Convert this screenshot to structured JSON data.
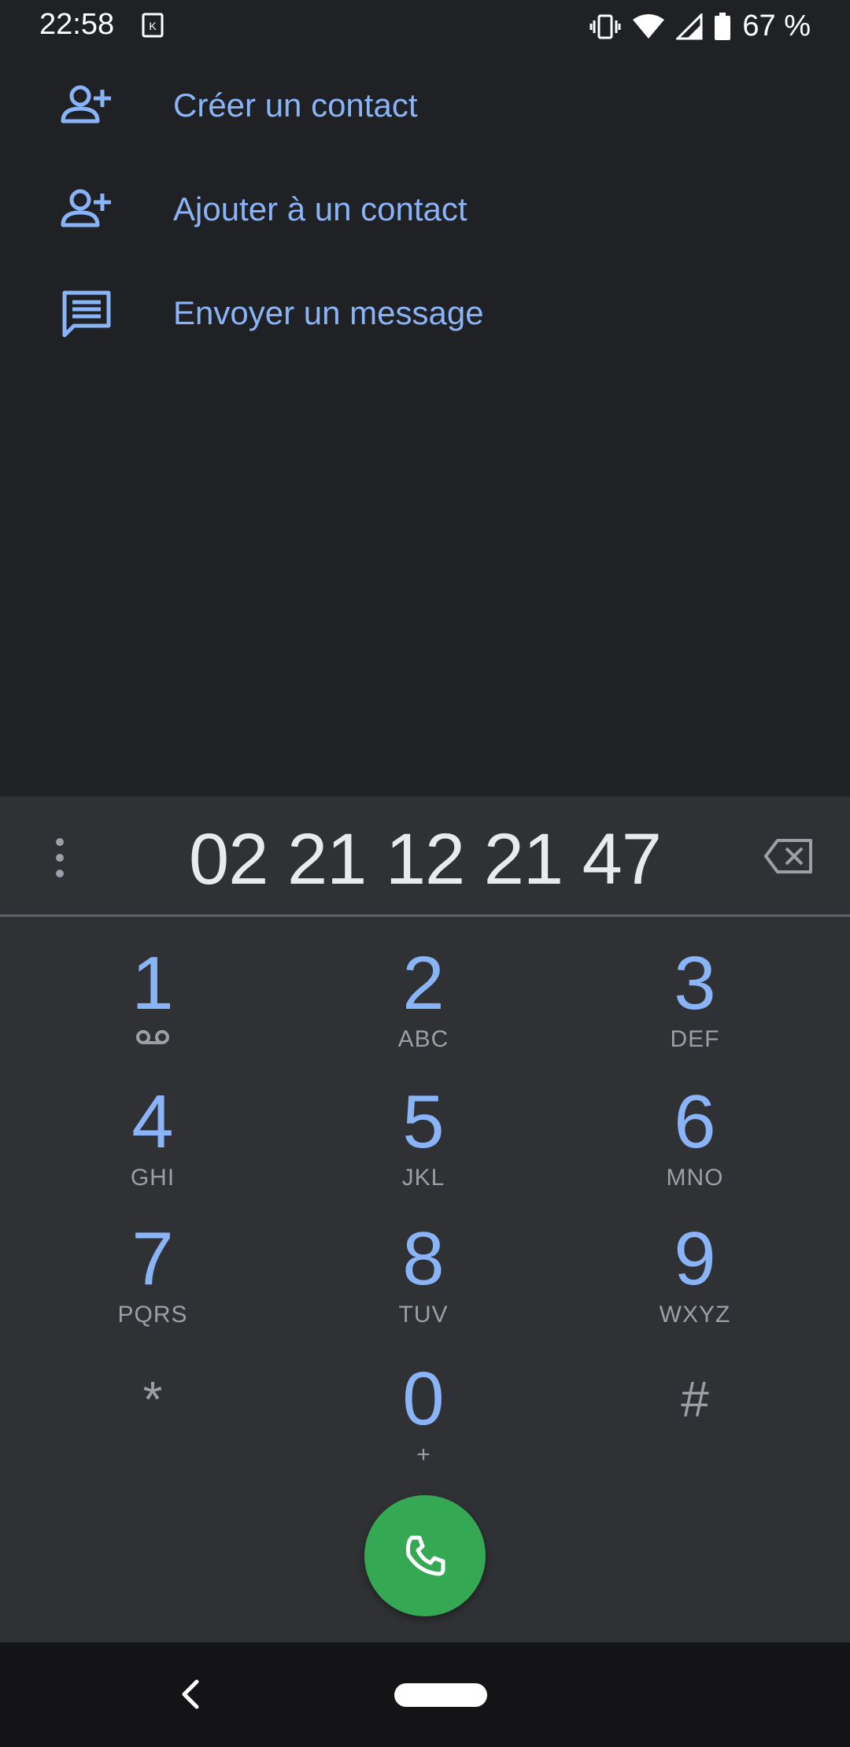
{
  "status_bar": {
    "time": "22:58",
    "battery_text": "67 %",
    "icons": [
      "notification-k-icon",
      "vibrate-icon",
      "wifi-icon",
      "signal-icon",
      "battery-icon"
    ]
  },
  "actions": [
    {
      "label": "Créer un contact",
      "icon": "person-add-icon"
    },
    {
      "label": "Ajouter à un contact",
      "icon": "person-add-icon"
    },
    {
      "label": "Envoyer un message",
      "icon": "message-icon"
    }
  ],
  "dialer": {
    "number": "02 21 12 21 47",
    "keys": [
      {
        "digit": "1",
        "letters": ""
      },
      {
        "digit": "2",
        "letters": "ABC"
      },
      {
        "digit": "3",
        "letters": "DEF"
      },
      {
        "digit": "4",
        "letters": "GHI"
      },
      {
        "digit": "5",
        "letters": "JKL"
      },
      {
        "digit": "6",
        "letters": "MNO"
      },
      {
        "digit": "7",
        "letters": "PQRS"
      },
      {
        "digit": "8",
        "letters": "TUV"
      },
      {
        "digit": "9",
        "letters": "WXYZ"
      },
      {
        "digit": "*",
        "letters": ""
      },
      {
        "digit": "0",
        "letters": "+"
      },
      {
        "digit": "#",
        "letters": ""
      }
    ]
  },
  "colors": {
    "background": "#202124",
    "dialpad": "#303134",
    "accent": "#8ab4f8",
    "call_button": "#34a853"
  }
}
